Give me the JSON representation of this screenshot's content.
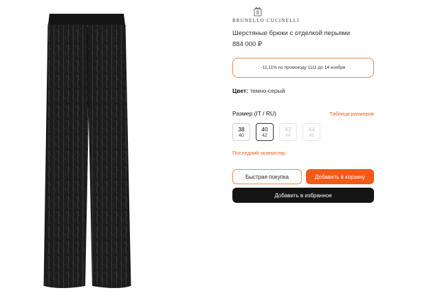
{
  "product": {
    "brand": "BRUNELLO CUCINELLI",
    "title": "Шерстяные брюки с отделкой перьями",
    "price": "884 000 ₽",
    "promo": "-11,11% по промокоду 1111 до 14 ноября",
    "color_label": "Цвет:",
    "color_value": "темно-серый",
    "size_label": "Размер (IT / RU)",
    "size_chart_link": "Таблица размеров",
    "sizes": [
      {
        "it": "38",
        "ru": "40",
        "state": "available"
      },
      {
        "it": "40",
        "ru": "42",
        "state": "selected"
      },
      {
        "it": "42",
        "ru": "44",
        "state": "unavailable"
      },
      {
        "it": "44",
        "ru": "46",
        "state": "unavailable"
      }
    ],
    "last_item": "Последний экземпляр",
    "quick_buy": "Быстрая покупка",
    "add_to_cart": "Добавить в корзину",
    "add_to_favorites": "Добавить в избранное"
  },
  "colors": {
    "accent": "#f25a17",
    "accent_border": "#f08a4b",
    "dark_button": "#141414",
    "product": "#181818"
  },
  "icons": {
    "brand_seal": "crown-seal-icon"
  }
}
